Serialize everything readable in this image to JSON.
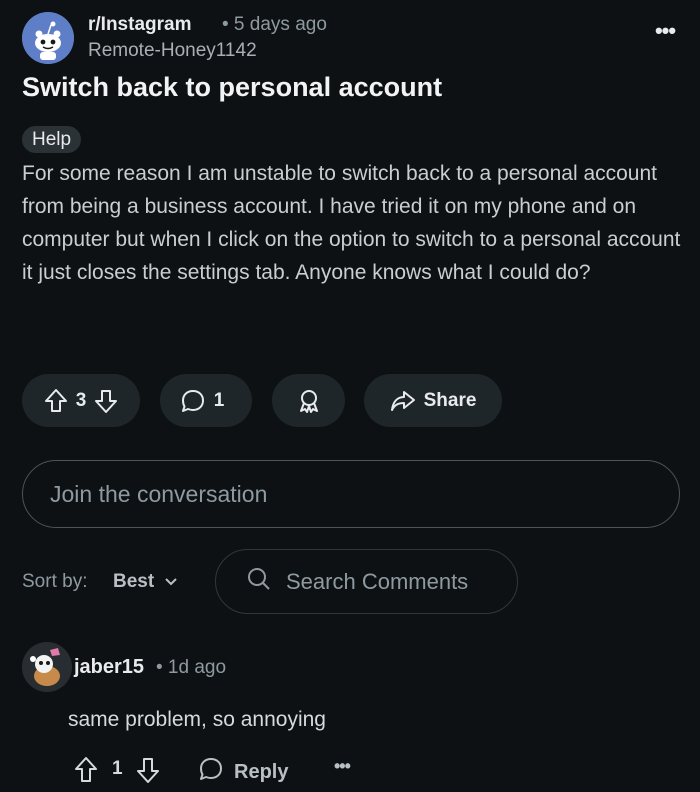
{
  "post": {
    "subreddit": "r/Instagram",
    "age": "• 5 days ago",
    "author": "Remote-Honey1142",
    "more_label": "•••",
    "title": "Switch back to personal account",
    "flair": "Help",
    "body": "For some reason I am unstable to switch back to a personal account from being a business account. I have tried it on my phone and on computer but when I click on the option to switch to a personal account it just closes the settings tab. Anyone knows what I could do?",
    "vote_count": "3",
    "comment_count": "1",
    "share_label": "Share"
  },
  "join": {
    "placeholder": "Join the conversation"
  },
  "sort": {
    "label": "Sort by:",
    "value": "Best"
  },
  "search": {
    "placeholder": "Search Comments"
  },
  "comment": {
    "username": "jaber15",
    "age": "• 1d ago",
    "text": "same problem, so annoying",
    "vote_count": "1",
    "reply_label": "Reply",
    "more_label": "•••"
  },
  "colors": {
    "background": "#0e1113",
    "pill": "#1f2629",
    "subreddit_avatar": "#5f7ec8",
    "muted_text": "#8e9aa1"
  },
  "icons": [
    "snoo-avatar-icon",
    "more-horizontal-icon",
    "upvote-icon",
    "downvote-icon",
    "comment-icon",
    "award-icon",
    "share-icon",
    "chevron-down-icon",
    "search-icon",
    "user-avatar-icon",
    "reply-icon"
  ]
}
